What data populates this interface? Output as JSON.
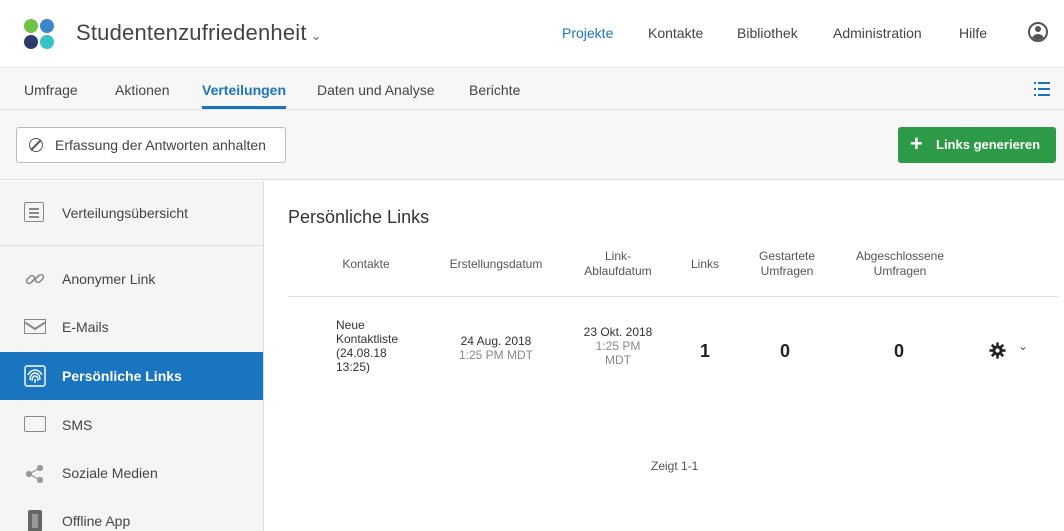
{
  "header": {
    "project_title": "Studentenzufriedenheit",
    "chevron": "⌄",
    "nav": {
      "projekte": "Projekte",
      "kontakte": "Kontakte",
      "bibliothek": "Bibliothek",
      "administration": "Administration",
      "hilfe": "Hilfe"
    }
  },
  "tabs": {
    "umfrage": "Umfrage",
    "aktionen": "Aktionen",
    "verteilungen": "Verteilungen",
    "daten": "Daten und Analyse",
    "berichte": "Berichte"
  },
  "toolbar": {
    "stop_label": "Erfassung der Antworten anhalten",
    "generate_label": "Links generieren",
    "generate_plus": "+"
  },
  "sidebar": {
    "items": [
      {
        "label": "Verteilungsübersicht",
        "icon": "list-document-icon"
      },
      {
        "label": "Anonymer Link",
        "icon": "link-icon"
      },
      {
        "label": "E-Mails",
        "icon": "envelope-icon"
      },
      {
        "label": "Persönliche Links",
        "icon": "fingerprint-icon"
      },
      {
        "label": "SMS",
        "icon": "sms-bubble-icon"
      },
      {
        "label": "Soziale Medien",
        "icon": "share-icon"
      },
      {
        "label": "Offline App",
        "icon": "phone-icon"
      }
    ]
  },
  "main": {
    "title": "Persönliche Links",
    "columns": {
      "kontakte": "Kontakte",
      "erstellungsdatum": "Erstellungsdatum",
      "ablauf_1": "Link-",
      "ablauf_2": "Ablaufdatum",
      "links": "Links",
      "gestartete_1": "Gestartete",
      "gestartete_2": "Umfragen",
      "abgeschlossene_1": "Abgeschlossene",
      "abgeschlossene_2": "Umfragen"
    },
    "row": {
      "kontakt_1": "Neue",
      "kontakt_2": "Kontaktliste",
      "kontakt_3": "(24.08.18",
      "kontakt_4": "13:25)",
      "erstellt_datum": "24 Aug. 2018",
      "erstellt_zeit": "1:25 PM MDT",
      "ablauf_datum": "23 Okt. 2018",
      "ablauf_zeit_1": "1:25 PM",
      "ablauf_zeit_2": "MDT",
      "links": "1",
      "gestartet": "0",
      "abgeschlossen": "0"
    },
    "pager": "Zeigt 1-1"
  },
  "colors": {
    "accent": "#1a75c1",
    "green": "#2d9a47"
  }
}
